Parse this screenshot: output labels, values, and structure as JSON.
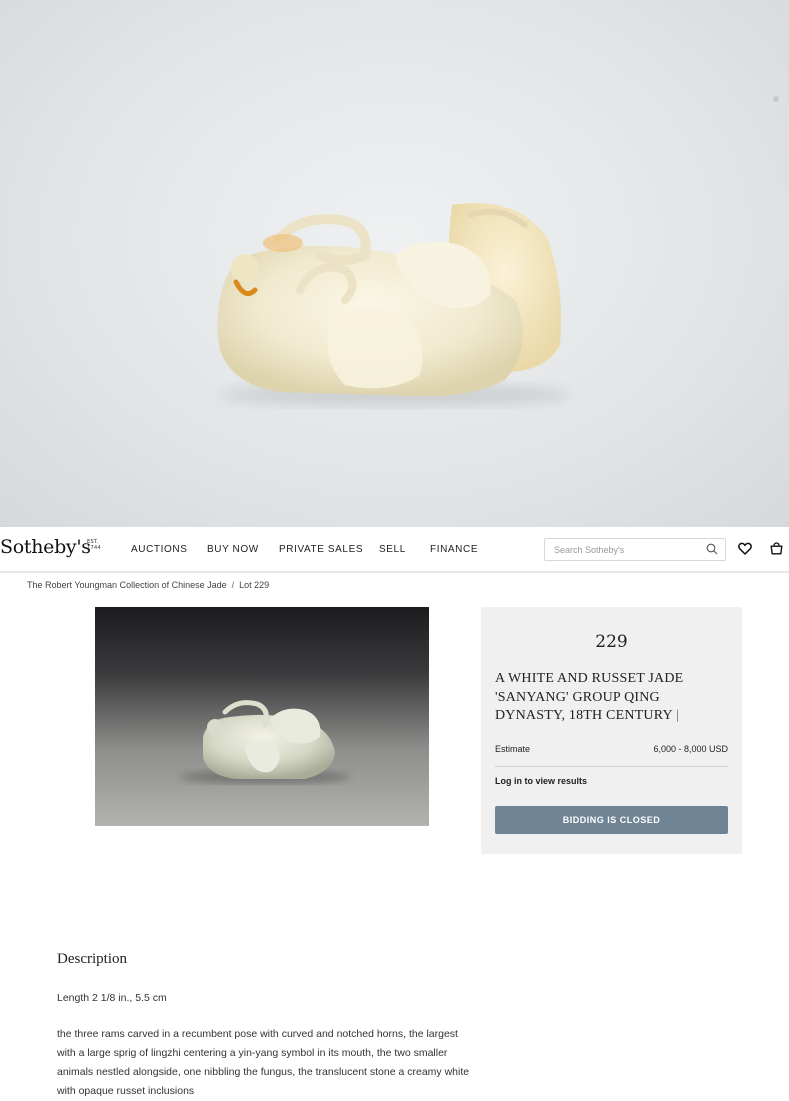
{
  "colors": {
    "button_bg": "#6f8494",
    "card_bg": "#f0f0f0",
    "nav_border": "#e6e6e6",
    "text": "#222222"
  },
  "header": {
    "logo": "Sotheby's",
    "logo_est": "EST. 1744",
    "nav": [
      "AUCTIONS",
      "BUY NOW",
      "PRIVATE SALES",
      "SELL",
      "FINANCE"
    ],
    "search_placeholder": "Search Sotheby's",
    "icons": [
      "search-icon",
      "heart-icon",
      "shopping-bag-icon"
    ]
  },
  "breadcrumb": {
    "collection": "The Robert Youngman Collection of Chinese Jade",
    "separator": "/",
    "lot": "Lot 229"
  },
  "lot": {
    "number": "229",
    "title": "A WHITE AND RUSSET JADE 'SANYANG' GROUP QING DYNASTY, 18TH CENTURY",
    "estimate_label": "Estimate",
    "estimate_value": "6,000 - 8,000 USD",
    "login_text": "Log in to view results",
    "button_label": "BIDDING IS CLOSED"
  },
  "description": {
    "heading": "Description",
    "length": "Length 2 1/8  in., 5.5 cm",
    "body": "the three rams carved in a recumbent pose with curved and notched horns, the largest with a large sprig of lingzhi centering a yin-yang symbol in its mouth, the two smaller animals nestled alongside, one nibbling the fungus, the translucent stone a creamy white with opaque russet inclusions"
  }
}
